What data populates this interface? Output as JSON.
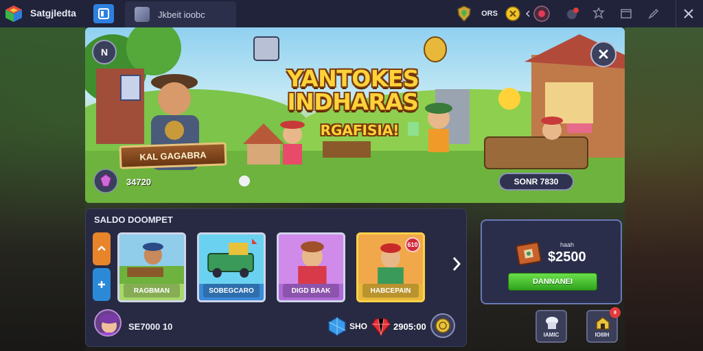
{
  "app": {
    "name": "Satgjledta",
    "tab_title": "Jkbeit ioobc"
  },
  "topbar": {
    "counter_label": "ORS",
    "icons": [
      "shield-icon",
      "coin-icon",
      "phone-icon",
      "notification-icon",
      "settings-icon",
      "window-icon",
      "edit-icon",
      "close-icon"
    ]
  },
  "banner": {
    "title_line1": "YANTOKES",
    "title_line2": "INDHARAS",
    "subtitle": "RGAFISIA!",
    "left_badge": "N",
    "ribbon_label": "KAL GAGABRA",
    "gem_amount": "34720",
    "price_label": "SONR 7830"
  },
  "collection": {
    "title": "SALDO DOOMPET",
    "cards": [
      {
        "name": "RAGBMAN"
      },
      {
        "name": "SOBEGCARO"
      },
      {
        "name": "DIGD BAAK"
      },
      {
        "name": "HABCEPAIN",
        "tag": "610"
      }
    ]
  },
  "footer": {
    "user_stat": "SE7000 10",
    "blue_currency": "SHO",
    "red_currency": "2905:00"
  },
  "offer": {
    "small_label": "haah",
    "price": "$2500",
    "buy_label": "DANNANEI"
  },
  "bottom_buttons": [
    {
      "label": "IAMIC"
    },
    {
      "label": "IOIIIH",
      "badge": "8"
    }
  ],
  "colors": {
    "accent_blue": "#2d80e0",
    "buy_green": "#3fb82a",
    "title_yellow": "#ffd23a",
    "panel_bg": "#272a42"
  }
}
